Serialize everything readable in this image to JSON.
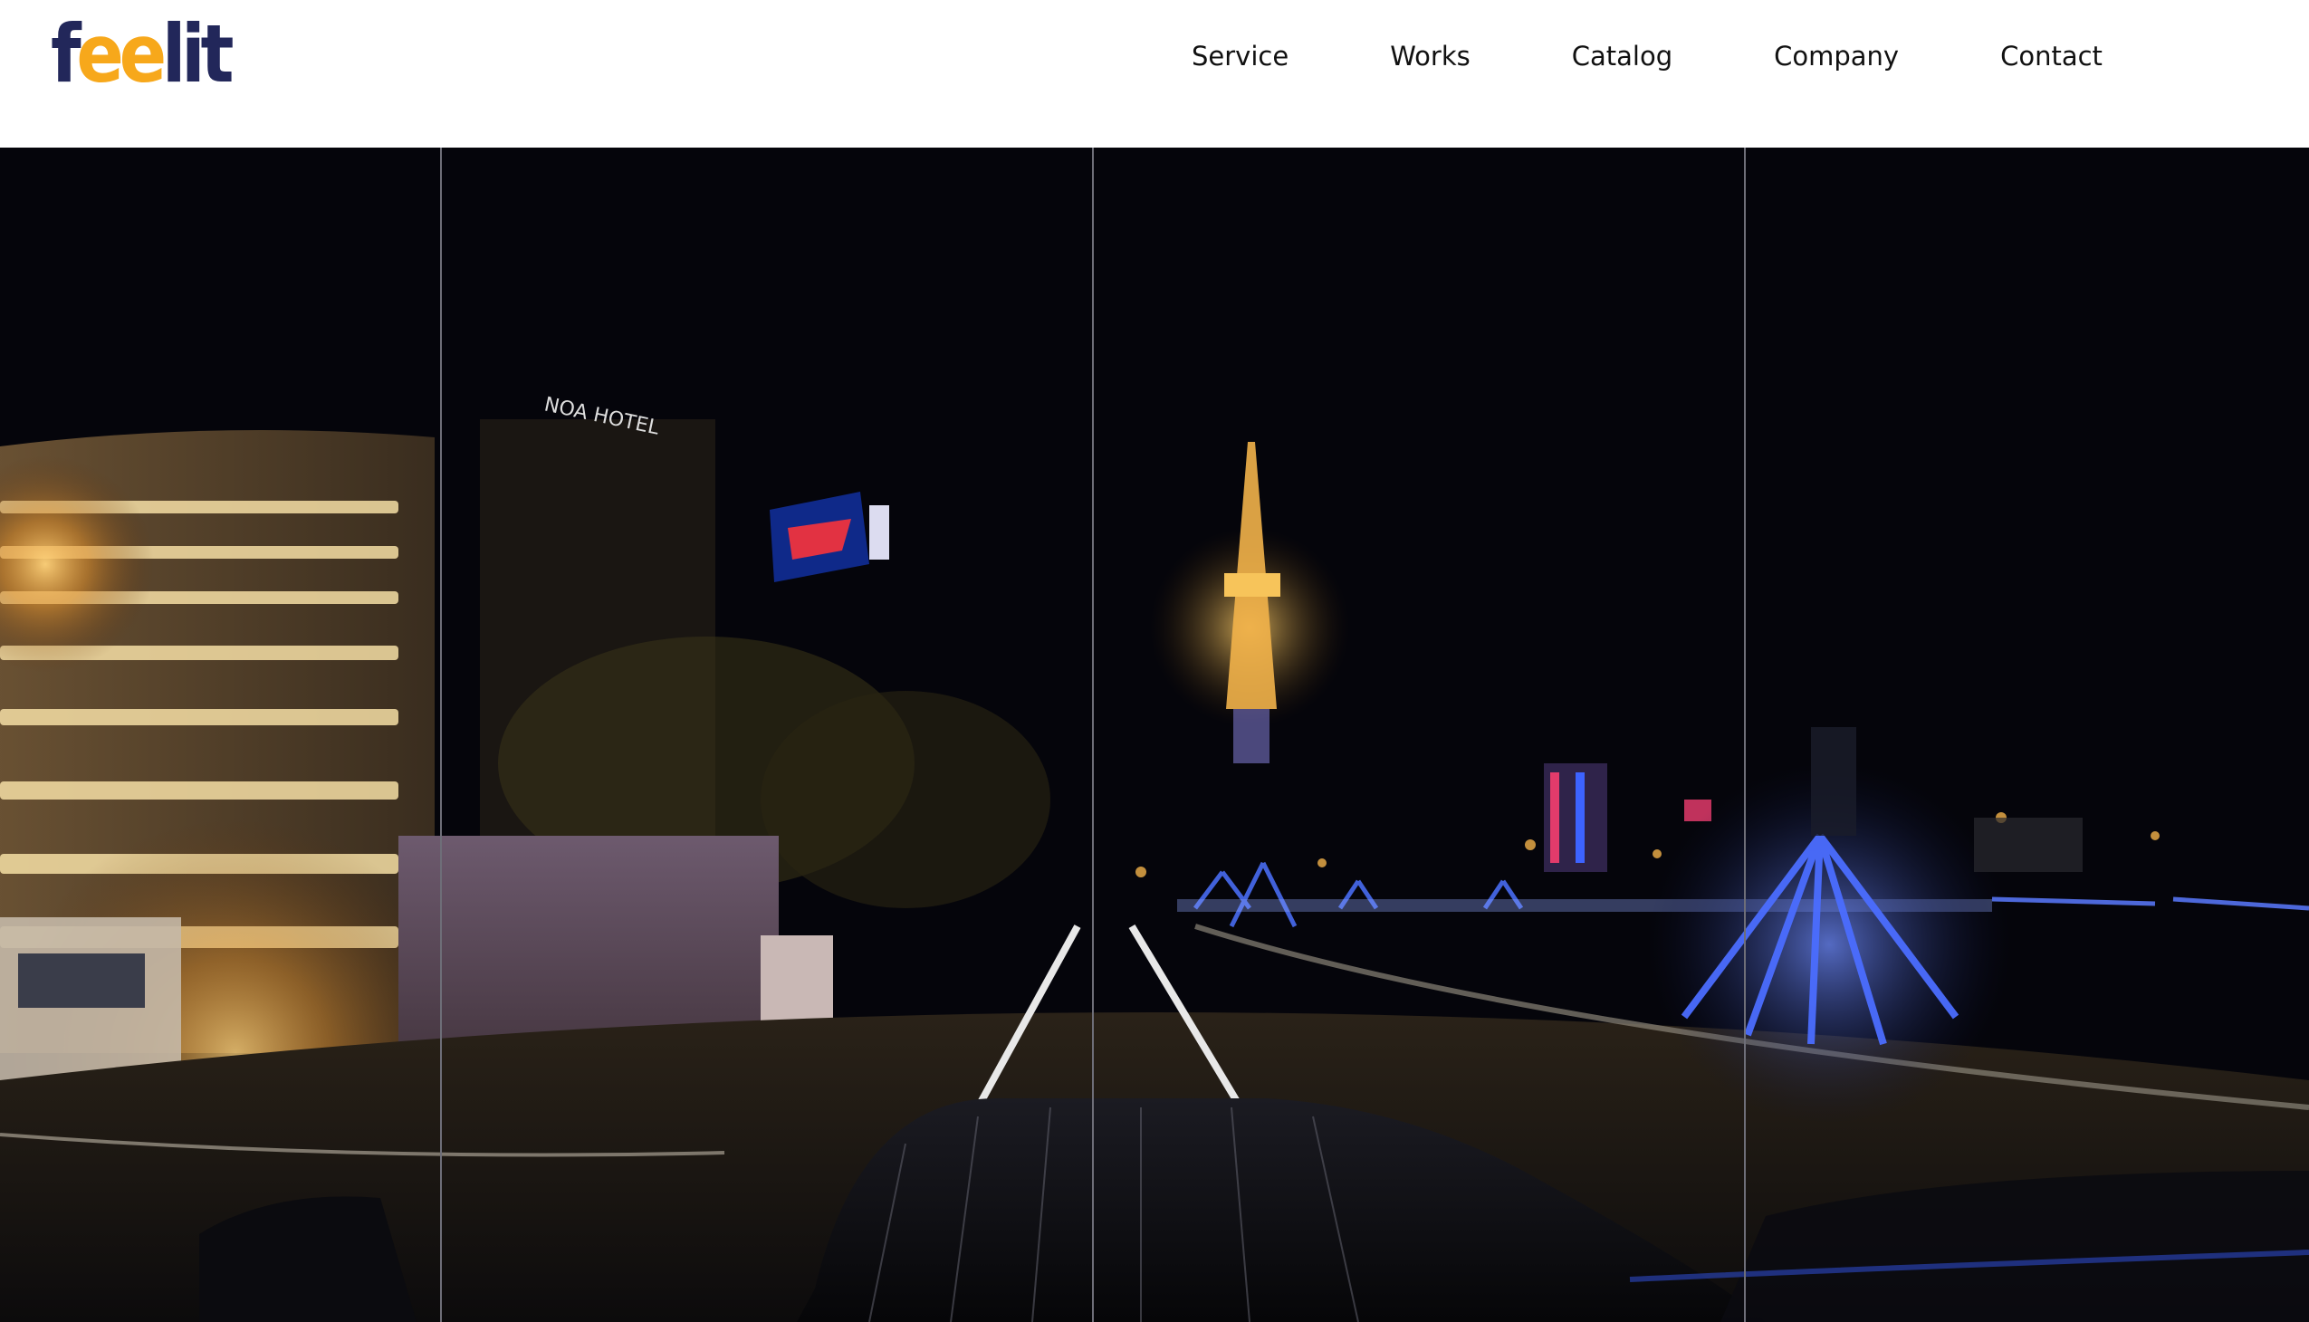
{
  "header": {
    "logo": {
      "part1": "f",
      "part2": "ee",
      "part3": "lit"
    },
    "nav": [
      {
        "label": "Service"
      },
      {
        "label": "Works"
      },
      {
        "label": "Catalog"
      },
      {
        "label": "Company"
      },
      {
        "label": "Contact"
      }
    ]
  },
  "hero": {
    "description_icon": "panorama-night-city-image",
    "colors": {
      "sky": "#05050b",
      "warm_light": "#f2b24a",
      "blue_illumination": "#3d63ff",
      "divider": "#6e6e78"
    }
  },
  "colors": {
    "brand_dark": "#22275a",
    "brand_accent": "#f7a81b",
    "nav_text": "#111111",
    "header_bg": "#ffffff"
  }
}
